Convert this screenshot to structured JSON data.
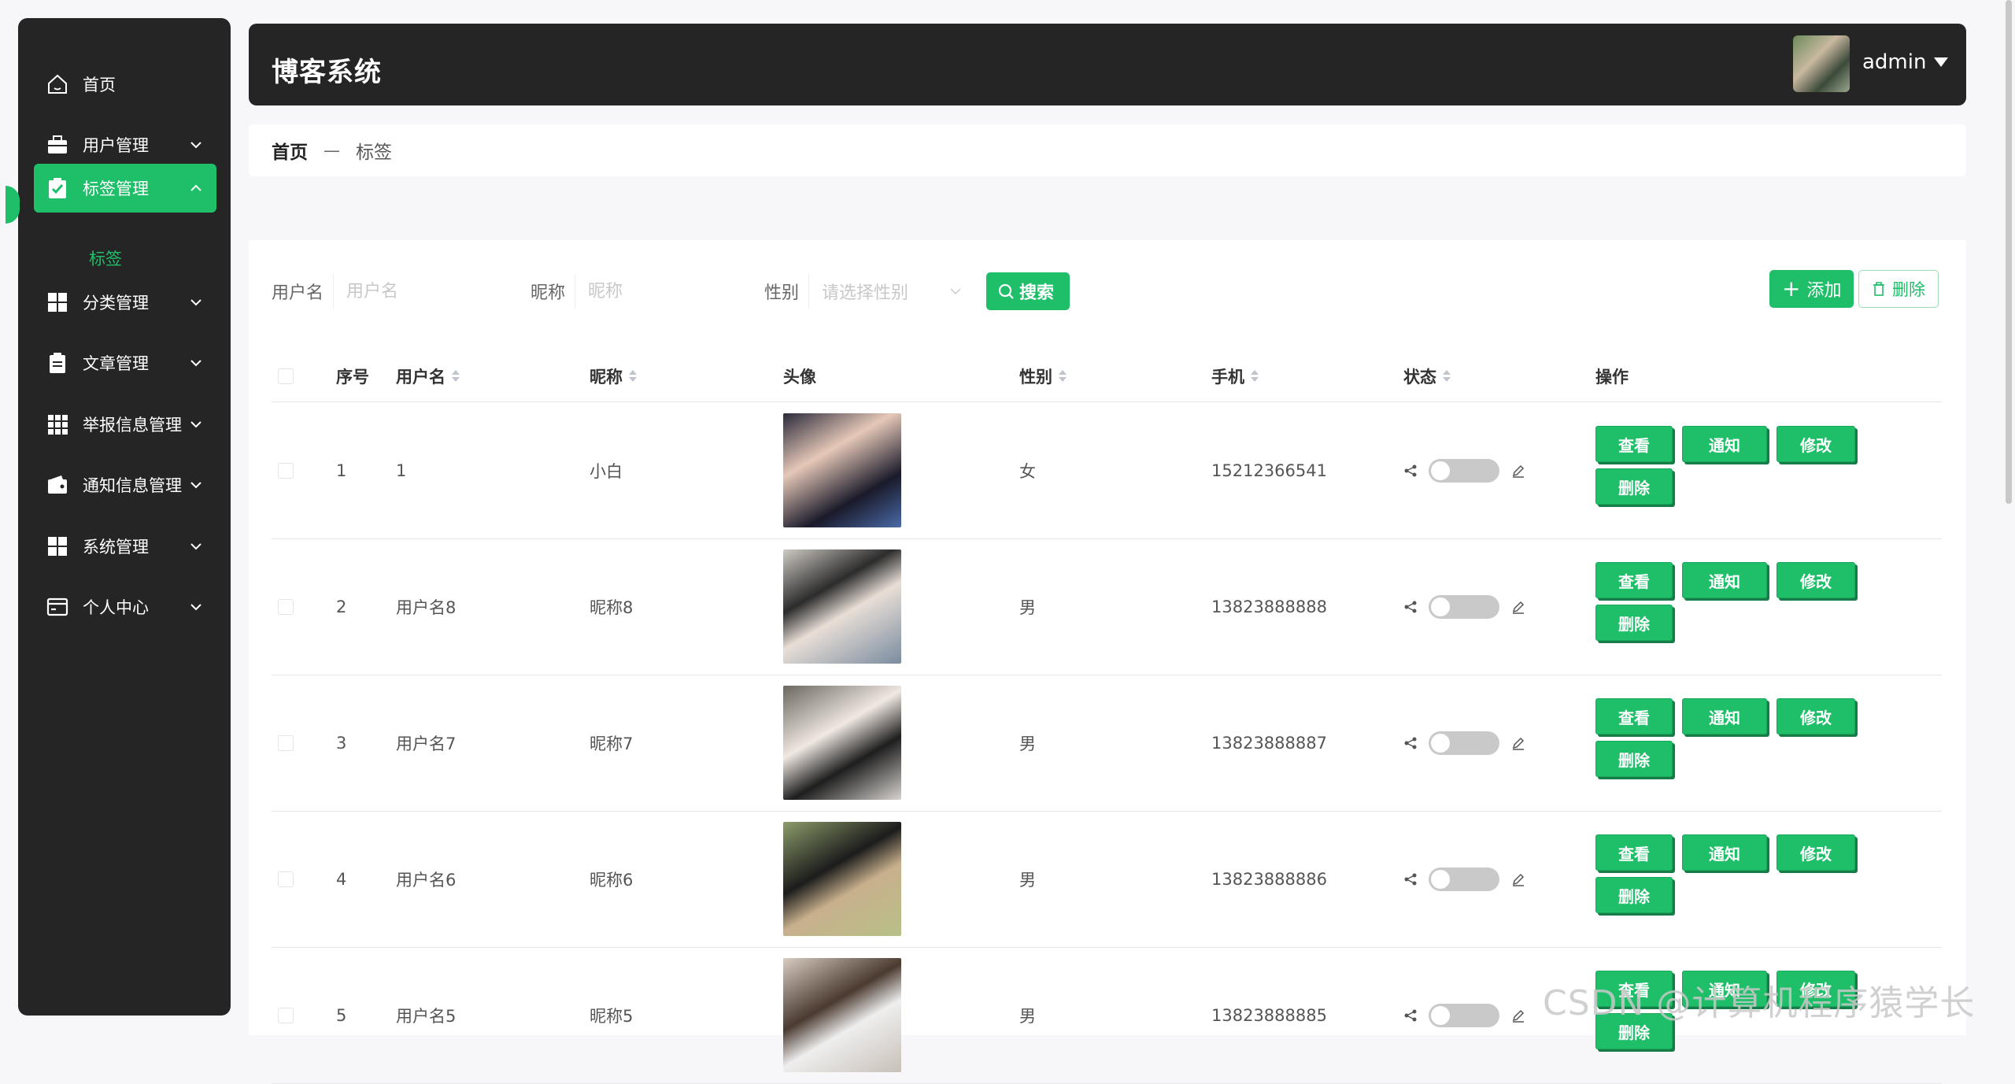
{
  "app": {
    "title": "博客系统",
    "user": "admin"
  },
  "sidebar": {
    "items": [
      {
        "label": "首页",
        "icon": "home-icon"
      },
      {
        "label": "用户管理",
        "icon": "briefcase-icon"
      },
      {
        "label": "标签管理",
        "icon": "clipboard-check-icon",
        "active": true
      },
      {
        "label": "分类管理",
        "icon": "grid-icon"
      },
      {
        "label": "文章管理",
        "icon": "clipboard-list-icon"
      },
      {
        "label": "举报信息管理",
        "icon": "apps-icon"
      },
      {
        "label": "通知信息管理",
        "icon": "wallet-icon"
      },
      {
        "label": "系统管理",
        "icon": "grid-icon"
      },
      {
        "label": "个人中心",
        "icon": "card-icon"
      }
    ],
    "sub_item": "标签"
  },
  "breadcrumb": {
    "home": "首页",
    "sep": "—",
    "current": "标签"
  },
  "search": {
    "username_label": "用户名",
    "username_placeholder": "用户名",
    "nickname_label": "昵称",
    "nickname_placeholder": "昵称",
    "gender_label": "性别",
    "gender_placeholder": "请选择性别",
    "search_button": "搜索"
  },
  "toolbar": {
    "add": "添加",
    "delete": "删除"
  },
  "table": {
    "headers": [
      "序号",
      "用户名",
      "昵称",
      "头像",
      "性别",
      "手机",
      "状态",
      "操作"
    ],
    "rows": [
      {
        "no": "1",
        "username": "1",
        "nickname": "小白",
        "gender": "女",
        "phone": "15212366541"
      },
      {
        "no": "2",
        "username": "用户名8",
        "nickname": "昵称8",
        "gender": "男",
        "phone": "13823888888"
      },
      {
        "no": "3",
        "username": "用户名7",
        "nickname": "昵称7",
        "gender": "男",
        "phone": "13823888887"
      },
      {
        "no": "4",
        "username": "用户名6",
        "nickname": "昵称6",
        "gender": "男",
        "phone": "13823888886"
      },
      {
        "no": "5",
        "username": "用户名5",
        "nickname": "昵称5",
        "gender": "男",
        "phone": "13823888885"
      }
    ],
    "actions": {
      "view": "查看",
      "notify": "通知",
      "edit": "修改",
      "delete": "删除"
    }
  },
  "watermark": "CSDN @计算机程序猿学长",
  "colors": {
    "accent": "#1fbf6a",
    "sidebar_bg": "#252525"
  }
}
